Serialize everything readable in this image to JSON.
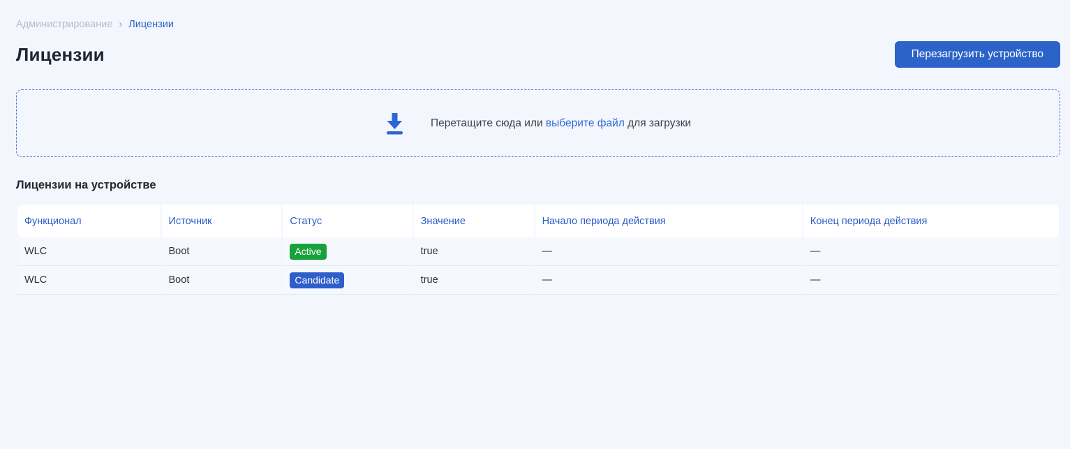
{
  "breadcrumb": {
    "items": [
      {
        "label": "Администрирование"
      },
      {
        "label": "Лицензии"
      }
    ],
    "separator": "›"
  },
  "page": {
    "title": "Лицензии"
  },
  "toolbar": {
    "reboot_button_label": "Перезагрузить устройство"
  },
  "dropzone": {
    "icon": "download-icon",
    "text_before": "Перетащите сюда или ",
    "link_label": "выберите файл",
    "text_after": " для загрузки"
  },
  "licenses_section": {
    "title": "Лицензии на устройстве",
    "columns": {
      "functional": "Функционал",
      "source": "Источник",
      "status": "Статус",
      "value": "Значение",
      "start": "Начало периода действия",
      "end": "Конец периода действия"
    },
    "rows": [
      {
        "functional": "WLC",
        "source": "Boot",
        "status": "Active",
        "status_color": "#18a23b",
        "value": "true",
        "start": "—",
        "end": "—"
      },
      {
        "functional": "WLC",
        "source": "Boot",
        "status": "Candidate",
        "status_color": "#2d5ec9",
        "value": "true",
        "start": "—",
        "end": "—"
      }
    ]
  },
  "colors": {
    "page_background": "#f3f6fc",
    "accent_blue": "#2a62c9",
    "button_blue": "#2b63c8",
    "dropzone_border_blue": "#5471d6",
    "status_active_green": "#18a23b",
    "status_candidate_blue": "#2d5ec9"
  }
}
